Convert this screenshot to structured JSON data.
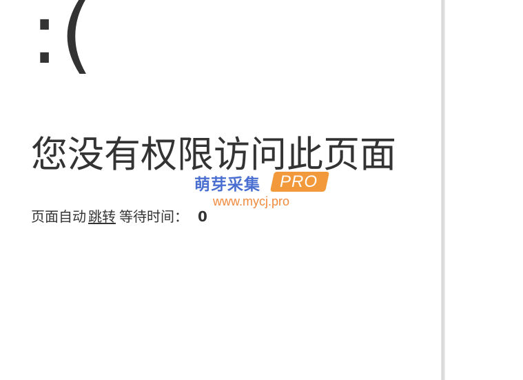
{
  "error_face": ":(",
  "title": "您没有权限访问此页面",
  "redirect": {
    "prefix": "页面自动",
    "link_label": "跳转",
    "wait_label": "等待时间：",
    "countdown": "0"
  },
  "watermark": {
    "brand": "萌芽采集",
    "badge": "PRO",
    "url": "www.mycj.pro",
    "colors": {
      "brand": "#4a6fd1",
      "badge_bg": "#f29a3b",
      "url": "#f08a3c"
    }
  }
}
